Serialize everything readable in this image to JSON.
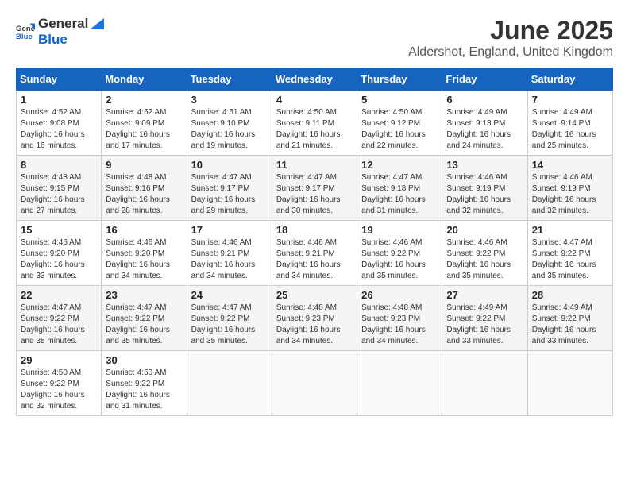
{
  "header": {
    "logo_general": "General",
    "logo_blue": "Blue",
    "month": "June 2025",
    "location": "Aldershot, England, United Kingdom"
  },
  "days_of_week": [
    "Sunday",
    "Monday",
    "Tuesday",
    "Wednesday",
    "Thursday",
    "Friday",
    "Saturday"
  ],
  "weeks": [
    [
      {
        "day": "1",
        "sunrise": "4:52 AM",
        "sunset": "9:08 PM",
        "daylight": "16 hours and 16 minutes."
      },
      {
        "day": "2",
        "sunrise": "4:52 AM",
        "sunset": "9:09 PM",
        "daylight": "16 hours and 17 minutes."
      },
      {
        "day": "3",
        "sunrise": "4:51 AM",
        "sunset": "9:10 PM",
        "daylight": "16 hours and 19 minutes."
      },
      {
        "day": "4",
        "sunrise": "4:50 AM",
        "sunset": "9:11 PM",
        "daylight": "16 hours and 21 minutes."
      },
      {
        "day": "5",
        "sunrise": "4:50 AM",
        "sunset": "9:12 PM",
        "daylight": "16 hours and 22 minutes."
      },
      {
        "day": "6",
        "sunrise": "4:49 AM",
        "sunset": "9:13 PM",
        "daylight": "16 hours and 24 minutes."
      },
      {
        "day": "7",
        "sunrise": "4:49 AM",
        "sunset": "9:14 PM",
        "daylight": "16 hours and 25 minutes."
      }
    ],
    [
      {
        "day": "8",
        "sunrise": "4:48 AM",
        "sunset": "9:15 PM",
        "daylight": "16 hours and 27 minutes."
      },
      {
        "day": "9",
        "sunrise": "4:48 AM",
        "sunset": "9:16 PM",
        "daylight": "16 hours and 28 minutes."
      },
      {
        "day": "10",
        "sunrise": "4:47 AM",
        "sunset": "9:17 PM",
        "daylight": "16 hours and 29 minutes."
      },
      {
        "day": "11",
        "sunrise": "4:47 AM",
        "sunset": "9:17 PM",
        "daylight": "16 hours and 30 minutes."
      },
      {
        "day": "12",
        "sunrise": "4:47 AM",
        "sunset": "9:18 PM",
        "daylight": "16 hours and 31 minutes."
      },
      {
        "day": "13",
        "sunrise": "4:46 AM",
        "sunset": "9:19 PM",
        "daylight": "16 hours and 32 minutes."
      },
      {
        "day": "14",
        "sunrise": "4:46 AM",
        "sunset": "9:19 PM",
        "daylight": "16 hours and 32 minutes."
      }
    ],
    [
      {
        "day": "15",
        "sunrise": "4:46 AM",
        "sunset": "9:20 PM",
        "daylight": "16 hours and 33 minutes."
      },
      {
        "day": "16",
        "sunrise": "4:46 AM",
        "sunset": "9:20 PM",
        "daylight": "16 hours and 34 minutes."
      },
      {
        "day": "17",
        "sunrise": "4:46 AM",
        "sunset": "9:21 PM",
        "daylight": "16 hours and 34 minutes."
      },
      {
        "day": "18",
        "sunrise": "4:46 AM",
        "sunset": "9:21 PM",
        "daylight": "16 hours and 34 minutes."
      },
      {
        "day": "19",
        "sunrise": "4:46 AM",
        "sunset": "9:22 PM",
        "daylight": "16 hours and 35 minutes."
      },
      {
        "day": "20",
        "sunrise": "4:46 AM",
        "sunset": "9:22 PM",
        "daylight": "16 hours and 35 minutes."
      },
      {
        "day": "21",
        "sunrise": "4:47 AM",
        "sunset": "9:22 PM",
        "daylight": "16 hours and 35 minutes."
      }
    ],
    [
      {
        "day": "22",
        "sunrise": "4:47 AM",
        "sunset": "9:22 PM",
        "daylight": "16 hours and 35 minutes."
      },
      {
        "day": "23",
        "sunrise": "4:47 AM",
        "sunset": "9:22 PM",
        "daylight": "16 hours and 35 minutes."
      },
      {
        "day": "24",
        "sunrise": "4:47 AM",
        "sunset": "9:22 PM",
        "daylight": "16 hours and 35 minutes."
      },
      {
        "day": "25",
        "sunrise": "4:48 AM",
        "sunset": "9:23 PM",
        "daylight": "16 hours and 34 minutes."
      },
      {
        "day": "26",
        "sunrise": "4:48 AM",
        "sunset": "9:23 PM",
        "daylight": "16 hours and 34 minutes."
      },
      {
        "day": "27",
        "sunrise": "4:49 AM",
        "sunset": "9:22 PM",
        "daylight": "16 hours and 33 minutes."
      },
      {
        "day": "28",
        "sunrise": "4:49 AM",
        "sunset": "9:22 PM",
        "daylight": "16 hours and 33 minutes."
      }
    ],
    [
      {
        "day": "29",
        "sunrise": "4:50 AM",
        "sunset": "9:22 PM",
        "daylight": "16 hours and 32 minutes."
      },
      {
        "day": "30",
        "sunrise": "4:50 AM",
        "sunset": "9:22 PM",
        "daylight": "16 hours and 31 minutes."
      },
      null,
      null,
      null,
      null,
      null
    ]
  ],
  "labels": {
    "sunrise": "Sunrise:",
    "sunset": "Sunset:",
    "daylight": "Daylight:"
  }
}
